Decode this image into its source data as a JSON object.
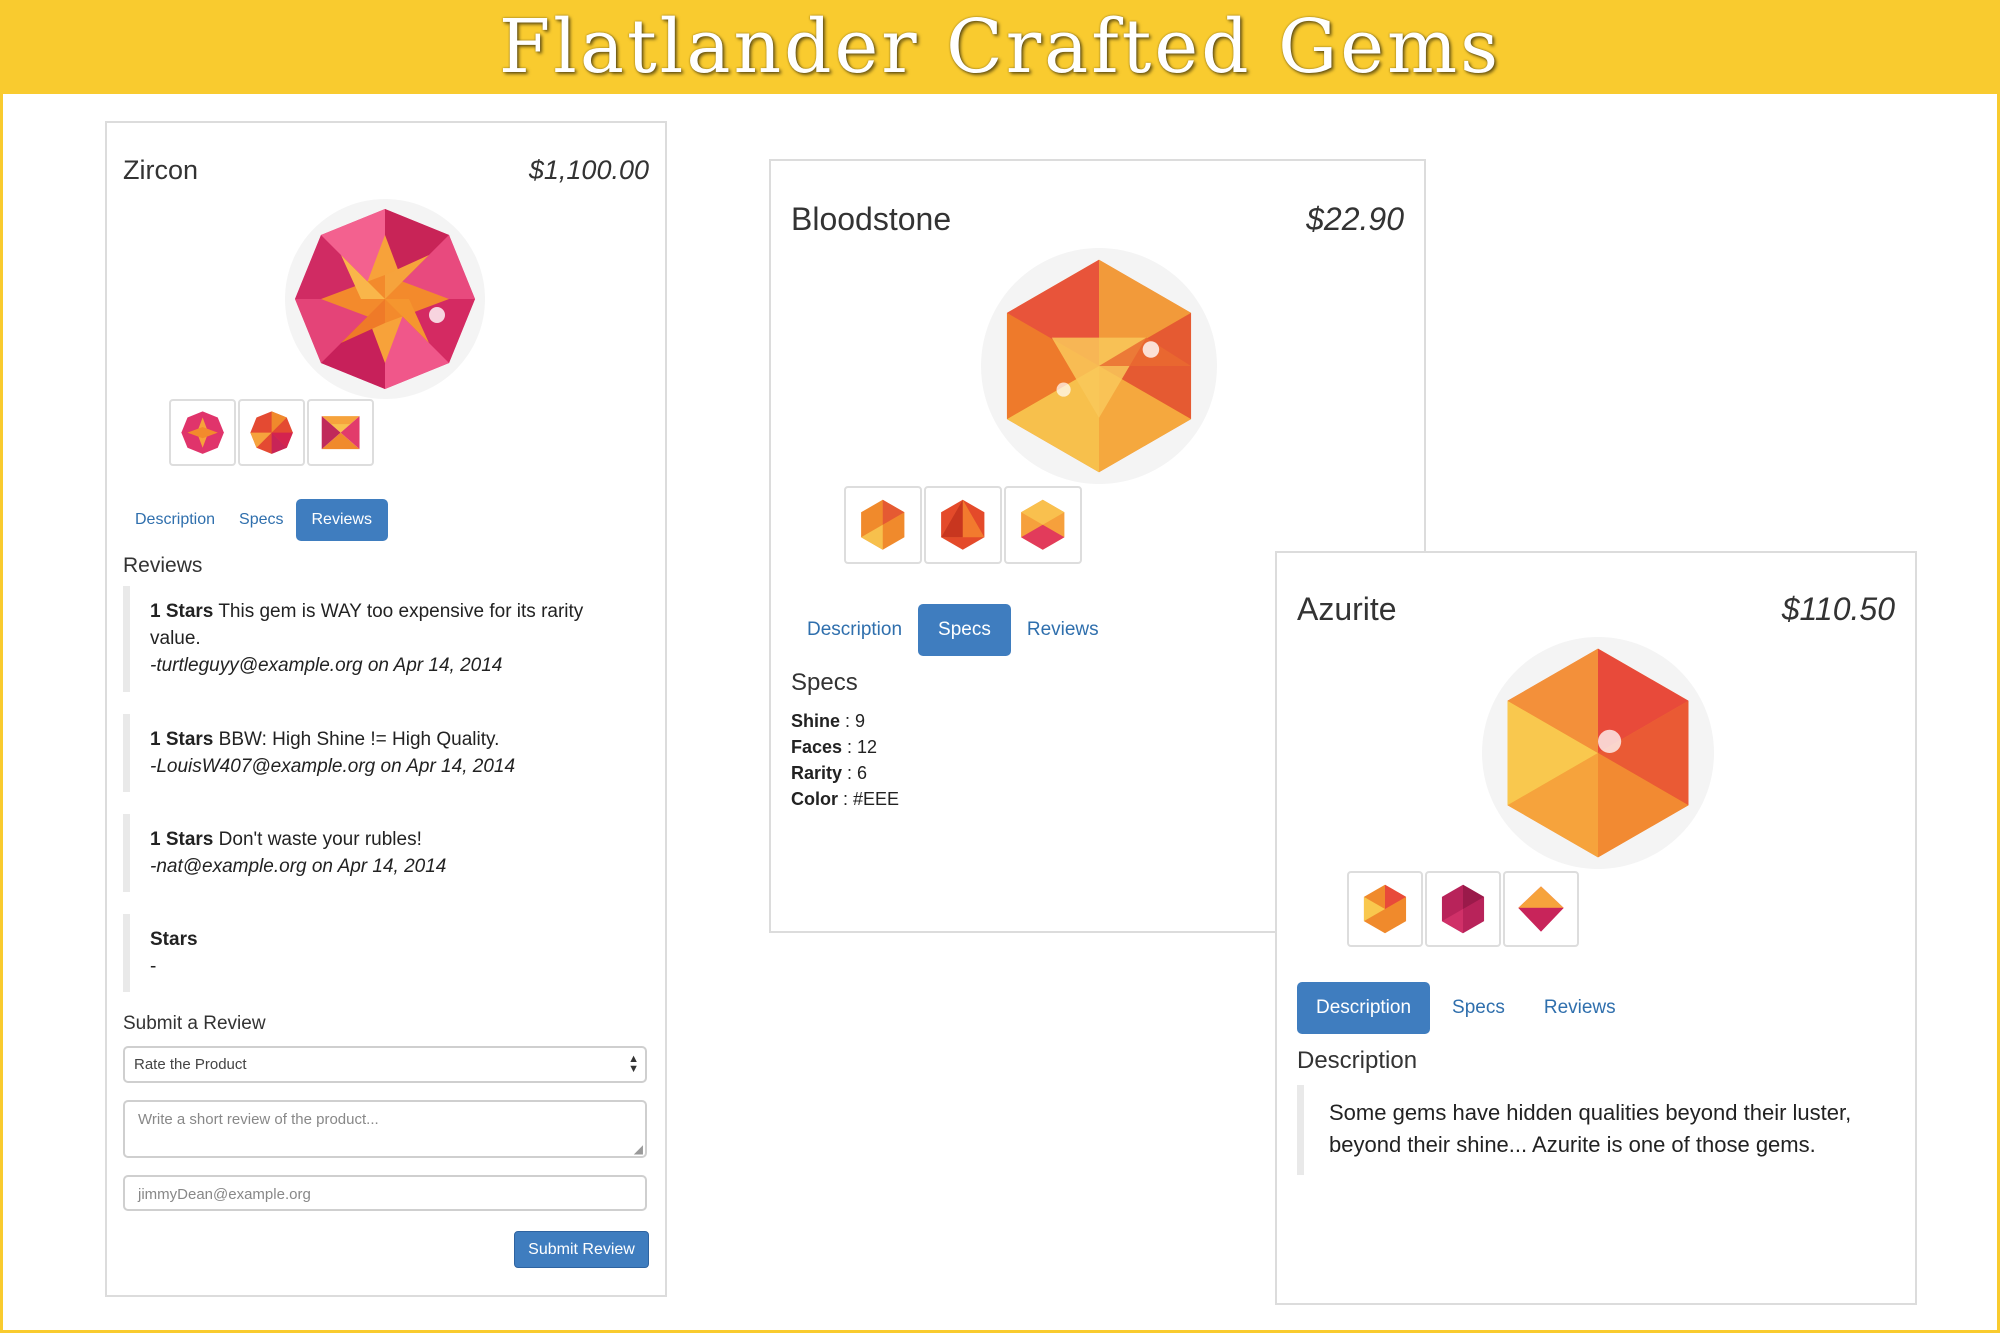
{
  "banner": {
    "title": "Flatlander Crafted Gems"
  },
  "colors": {
    "banner": "#f9cb2f",
    "accent": "#3f7dbf",
    "link": "#2f6fad"
  },
  "products": {
    "zircon": {
      "name": "Zircon",
      "price": "$1,100.00",
      "tabs": [
        "Description",
        "Specs",
        "Reviews"
      ],
      "active_tab": "Reviews",
      "section_title": "Reviews",
      "reviews": [
        {
          "stars": "1 Stars",
          "body": "This gem is WAY too expensive for its rarity value.",
          "author": "-turtleguyy@example.org on Apr 14, 2014"
        },
        {
          "stars": "1 Stars",
          "body": "BBW: High Shine != High Quality.",
          "author": "-LouisW407@example.org on Apr 14, 2014"
        },
        {
          "stars": "1 Stars",
          "body": "Don't waste your rubles!",
          "author": "-nat@example.org on Apr 14, 2014"
        },
        {
          "stars": "Stars",
          "body": "",
          "author": "-"
        }
      ],
      "form": {
        "title": "Submit a Review",
        "rate_select": "Rate the Product",
        "review_placeholder": "Write a short review of the product...",
        "email_placeholder": "jimmyDean@example.org",
        "submit_label": "Submit Review"
      }
    },
    "bloodstone": {
      "name": "Bloodstone",
      "price": "$22.90",
      "tabs": [
        "Description",
        "Specs",
        "Reviews"
      ],
      "active_tab": "Specs",
      "section_title": "Specs",
      "specs": [
        {
          "label": "Shine",
          "value": " : 9"
        },
        {
          "label": "Faces",
          "value": " : 12"
        },
        {
          "label": "Rarity",
          "value": " : 6"
        },
        {
          "label": "Color",
          "value": " : #EEE"
        }
      ]
    },
    "azurite": {
      "name": "Azurite",
      "price": "$110.50",
      "tabs": [
        "Description",
        "Specs",
        "Reviews"
      ],
      "active_tab": "Description",
      "section_title": "Description",
      "description": "Some gems have hidden qualities beyond their luster, beyond their shine... Azurite is one of those gems."
    }
  },
  "icons": {
    "zircon_hero": "octagon-gem-icon",
    "bloodstone_hero": "hexagon-gem-icon",
    "azurite_hero": "hexagon-gem-icon",
    "select_arrow": "updown-arrow-icon",
    "textarea_resize": "resize-handle-icon"
  }
}
